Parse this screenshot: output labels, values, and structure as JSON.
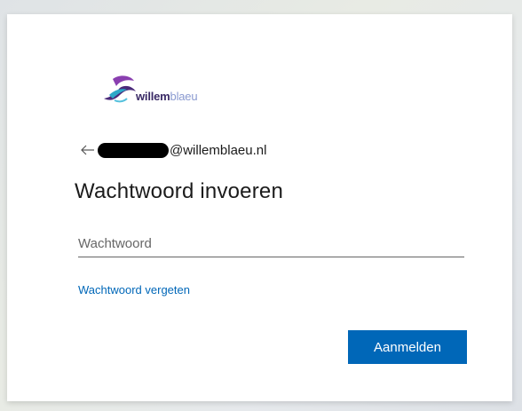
{
  "logo": {
    "brand_bold": "willem",
    "brand_light": "blaeu",
    "icon": "willemblaeu-swoosh-logo"
  },
  "identity": {
    "back_icon": "arrow-left-icon",
    "email_domain": "@willemblaeu.nl"
  },
  "heading": "Wachtwoord invoeren",
  "password": {
    "placeholder": "Wachtwoord",
    "value": ""
  },
  "forgot_link": "Wachtwoord vergeten",
  "signin_button": "Aanmelden",
  "colors": {
    "accent": "#0067b8",
    "text": "#1b1b1b"
  }
}
